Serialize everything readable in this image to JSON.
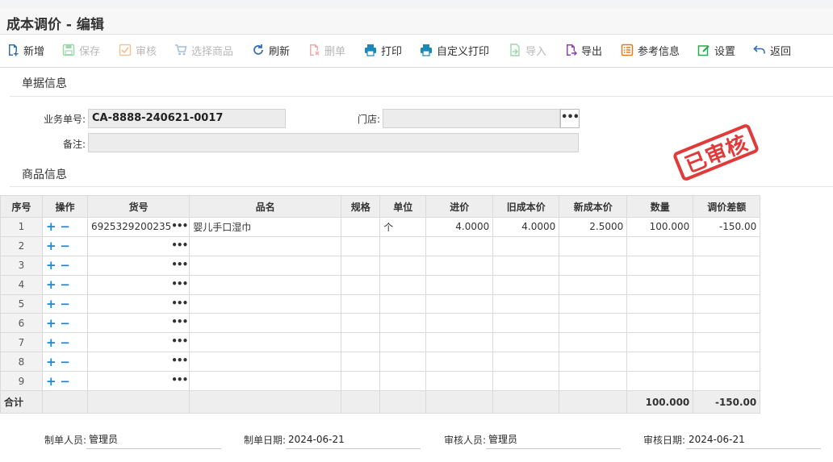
{
  "page_title": "成本调价 - 编辑",
  "toolbar": [
    {
      "label": "新增",
      "icon": "doc-add-icon",
      "enabled": true
    },
    {
      "label": "保存",
      "icon": "save-icon",
      "enabled": false
    },
    {
      "label": "审核",
      "icon": "check-icon",
      "enabled": false
    },
    {
      "label": "选择商品",
      "icon": "cart-icon",
      "enabled": false
    },
    {
      "label": "刷新",
      "icon": "refresh-icon",
      "enabled": true
    },
    {
      "label": "删单",
      "icon": "doc-delete-icon",
      "enabled": false
    },
    {
      "label": "打印",
      "icon": "printer-icon",
      "enabled": true
    },
    {
      "label": "自定义打印",
      "icon": "printer-icon",
      "enabled": true
    },
    {
      "label": "导入",
      "icon": "import-icon",
      "enabled": false
    },
    {
      "label": "导出",
      "icon": "export-icon",
      "enabled": true
    },
    {
      "label": "参考信息",
      "icon": "info-list-icon",
      "enabled": true
    },
    {
      "label": "设置",
      "icon": "settings-edit-icon",
      "enabled": true
    },
    {
      "label": "返回",
      "icon": "back-icon",
      "enabled": true
    }
  ],
  "doc_section": {
    "title": "单据信息",
    "order_no_label": "业务单号:",
    "order_no": "CA-8888-240621-0017",
    "store_label": "门店:",
    "store_value": "",
    "remark_label": "备注:",
    "remark_value": ""
  },
  "stamp_text": "已审核",
  "goods_section": {
    "title": "商品信息"
  },
  "table": {
    "columns": [
      "序号",
      "操作",
      "货号",
      "品名",
      "规格",
      "单位",
      "进价",
      "旧成本价",
      "新成本价",
      "数量",
      "调价差额"
    ],
    "rows": [
      {
        "seq": "1",
        "code": "6925329200235",
        "name": "婴儿手口湿巾",
        "spec": "",
        "unit": "个",
        "purchase_price": "4.0000",
        "old_cost": "4.0000",
        "new_cost": "2.5000",
        "qty": "100.000",
        "diff": "-150.00"
      },
      {
        "seq": "2",
        "code": "",
        "name": "",
        "spec": "",
        "unit": "",
        "purchase_price": "",
        "old_cost": "",
        "new_cost": "",
        "qty": "",
        "diff": ""
      },
      {
        "seq": "3",
        "code": "",
        "name": "",
        "spec": "",
        "unit": "",
        "purchase_price": "",
        "old_cost": "",
        "new_cost": "",
        "qty": "",
        "diff": ""
      },
      {
        "seq": "4",
        "code": "",
        "name": "",
        "spec": "",
        "unit": "",
        "purchase_price": "",
        "old_cost": "",
        "new_cost": "",
        "qty": "",
        "diff": ""
      },
      {
        "seq": "5",
        "code": "",
        "name": "",
        "spec": "",
        "unit": "",
        "purchase_price": "",
        "old_cost": "",
        "new_cost": "",
        "qty": "",
        "diff": ""
      },
      {
        "seq": "6",
        "code": "",
        "name": "",
        "spec": "",
        "unit": "",
        "purchase_price": "",
        "old_cost": "",
        "new_cost": "",
        "qty": "",
        "diff": ""
      },
      {
        "seq": "7",
        "code": "",
        "name": "",
        "spec": "",
        "unit": "",
        "purchase_price": "",
        "old_cost": "",
        "new_cost": "",
        "qty": "",
        "diff": ""
      },
      {
        "seq": "8",
        "code": "",
        "name": "",
        "spec": "",
        "unit": "",
        "purchase_price": "",
        "old_cost": "",
        "new_cost": "",
        "qty": "",
        "diff": ""
      },
      {
        "seq": "9",
        "code": "",
        "name": "",
        "spec": "",
        "unit": "",
        "purchase_price": "",
        "old_cost": "",
        "new_cost": "",
        "qty": "",
        "diff": ""
      }
    ],
    "total": {
      "label": "合计",
      "qty": "100.000",
      "diff": "-150.00"
    }
  },
  "footer": {
    "maker_label": "制单人员:",
    "maker": "管理员",
    "make_date_label": "制单日期:",
    "make_date": "2024-06-21",
    "auditor_label": "审核人员:",
    "auditor": "管理员",
    "audit_date_label": "审核日期:",
    "audit_date": "2024-06-21"
  }
}
